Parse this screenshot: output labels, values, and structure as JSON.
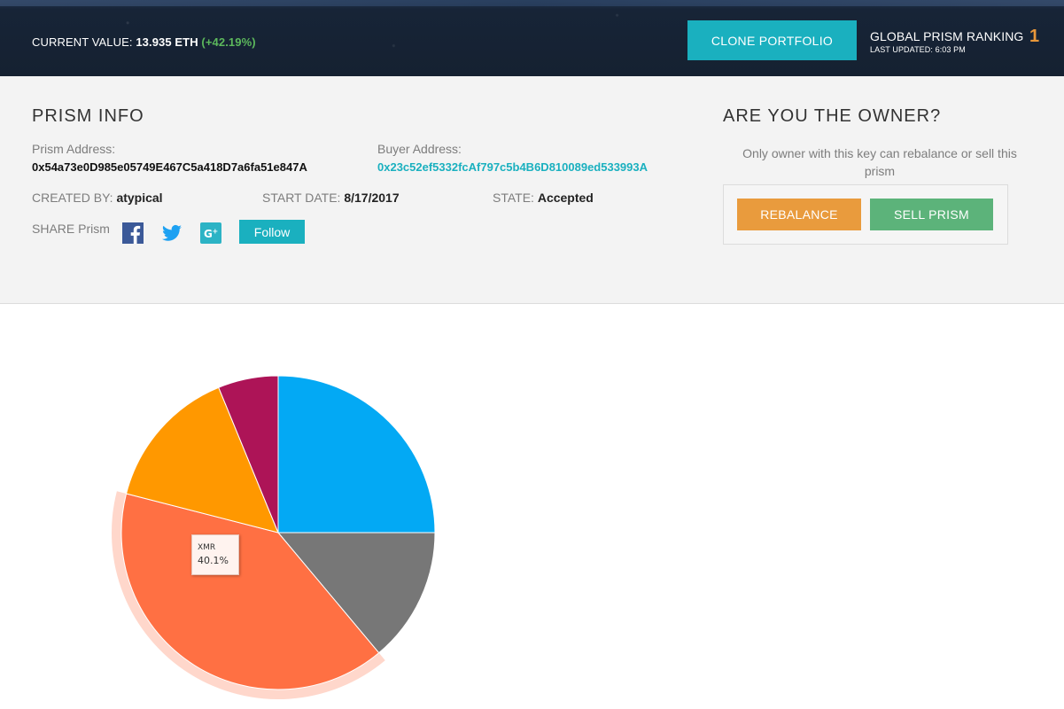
{
  "header": {
    "current_value_label": "CURRENT VALUE:",
    "current_value_amount": "13.935 ETH",
    "current_value_change": "(+42.19%)",
    "clone_button": "CLONE PORTFOLIO",
    "ranking_label": "GLOBAL PRISM RANKING",
    "ranking_value": "1",
    "last_updated": "LAST UPDATED: 6:03 PM"
  },
  "prism_info": {
    "title": "PRISM INFO",
    "prism_address_label": "Prism Address:",
    "prism_address": "0x54a73e0D985e05749E467C5a418D7a6fa51e847A",
    "buyer_address_label": "Buyer Address:",
    "buyer_address": "0x23c52ef5332fcAf797c5b4B6D810089ed533993A",
    "created_by_label": "CREATED BY:",
    "created_by": "atypical",
    "start_date_label": "START DATE:",
    "start_date": "8/17/2017",
    "state_label": "STATE:",
    "state": "Accepted",
    "share_label": "SHARE Prism",
    "follow_button": "Follow"
  },
  "owner": {
    "title": "ARE YOU THE OWNER?",
    "note": "Only owner with this key can rebalance or sell this prism",
    "rebalance_button": "REBALANCE",
    "sell_button": "SELL PRISM"
  },
  "colors": {
    "accent": "#1ab0bf",
    "positive": "#5cb85c",
    "ranking": "#e8973a",
    "rebalance": "#e99b3d",
    "sell": "#5cb37a"
  },
  "icons": [
    "facebook-icon",
    "twitter-icon",
    "google-plus-icon"
  ],
  "chart_data": {
    "type": "pie",
    "slices": [
      {
        "label": "",
        "value": 25.0,
        "color": "#03a9f4"
      },
      {
        "label": "",
        "value": 13.9,
        "color": "#777777"
      },
      {
        "label": "XMR",
        "value": 40.1,
        "color": "#ff7043",
        "highlighted": true
      },
      {
        "label": "",
        "value": 14.8,
        "color": "#ff9800"
      },
      {
        "label": "",
        "value": 6.2,
        "color": "#ad1457"
      }
    ],
    "tooltip": {
      "label": "XMR",
      "value": "40.1%"
    }
  }
}
